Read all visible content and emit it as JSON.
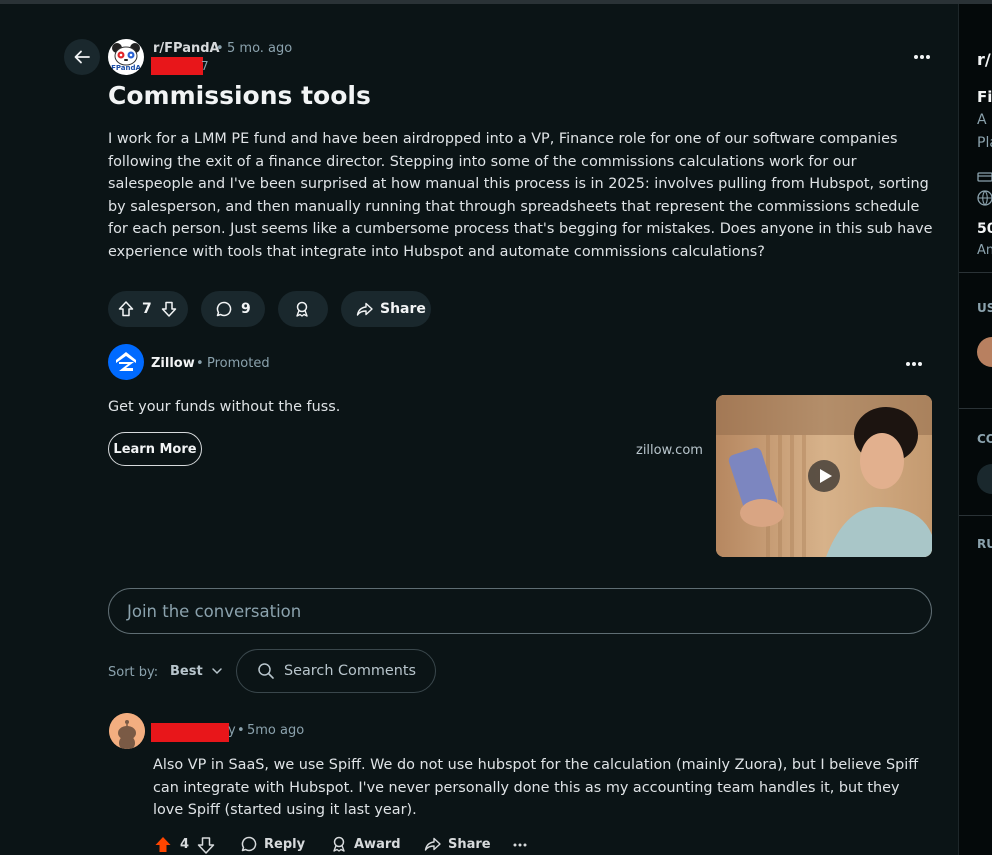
{
  "post": {
    "subreddit": "r/FPandA",
    "subreddit_avatar_text": "FPandA",
    "time_ago": "5 mo. ago",
    "author_suffix": "7",
    "title": "Commissions tools",
    "body": "I work for a LMM PE fund and have been airdropped into a VP, Finance role for one of our software companies following the exit of a finance director. Stepping into some of the commissions calculations work for our salespeople and I've been surprised at how manual this process is in 2025: involves pulling from Hubspot, sorting by salesperson, and then manually running that through spreadsheets that represent the commissions schedule for each person. Just seems like a cumbersome process that's begging for mistakes. Does anyone in this sub have experience with tools that integrate into Hubspot and automate commissions calculations?",
    "votes": "7",
    "comments": "9",
    "share_label": "Share"
  },
  "ad": {
    "advertiser": "Zillow",
    "promoted_label": "Promoted",
    "headline": "Get your funds without the fuss.",
    "cta_label": "Learn More",
    "domain": "zillow.com"
  },
  "comments_section": {
    "input_placeholder": "Join the conversation",
    "sort_label": "Sort by:",
    "sort_value": "Best",
    "search_placeholder": "Search Comments"
  },
  "comment": {
    "author_suffix": "y",
    "time_ago": "5mo ago",
    "text": "Also VP in SaaS, we use Spiff. We do not use hubspot for the calculation (mainly Zuora), but I believe Spiff can integrate with Hubspot. I've never personally done this as my accounting team handles it, but they love Spiff (started using it last year).",
    "votes": "4",
    "reply_label": "Reply",
    "award_label": "Award",
    "share_label": "Share"
  },
  "sidebar": {
    "sub_prefix": "r/",
    "line1": "Fi",
    "line2": "A",
    "line3": "Pla",
    "stat": "50",
    "stat_label": "An",
    "section_users": "US",
    "section_co": "CO",
    "section_ru": "RU"
  },
  "colors": {
    "background": "#0b1416",
    "button_bg": "#1a282d",
    "upvote_active": "#ff4500",
    "zillow_blue": "#006aff",
    "redaction": "#e8161a"
  }
}
